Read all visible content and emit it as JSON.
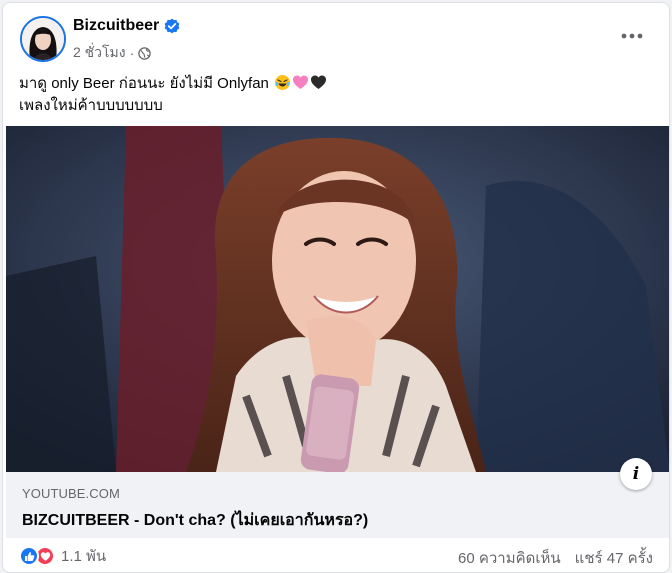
{
  "post": {
    "author": "Bizcuitbeer",
    "time": "2 ชั่วโมง",
    "separator": "·",
    "lines": [
      "มาดู only Beer ก่อนนะ ยังไม่มี Onlyfan",
      "เพลงใหม่ค้าบบบบบบบ"
    ],
    "emojis": [
      "rolling-on-floor-laughing-emoji",
      "pink-heart-emoji",
      "black-heart-emoji"
    ]
  },
  "link_preview": {
    "domain": "YOUTUBE.COM",
    "title": "BIZCUITBEER - Don't cha? (ไม่เคยเอากันหรอ?)"
  },
  "footer": {
    "reaction_count": "1.1 พัน",
    "comments": "60 ความคิดเห็น",
    "shares": "แชร์ 47 ครั้ง"
  },
  "colors": {
    "accent": "#1877f2",
    "love": "#f33e58",
    "secondary_text": "#65676b"
  },
  "icons": [
    "verified-badge-icon",
    "globe-icon",
    "more-options-icon",
    "info-icon",
    "like-reaction-icon",
    "love-reaction-icon"
  ]
}
